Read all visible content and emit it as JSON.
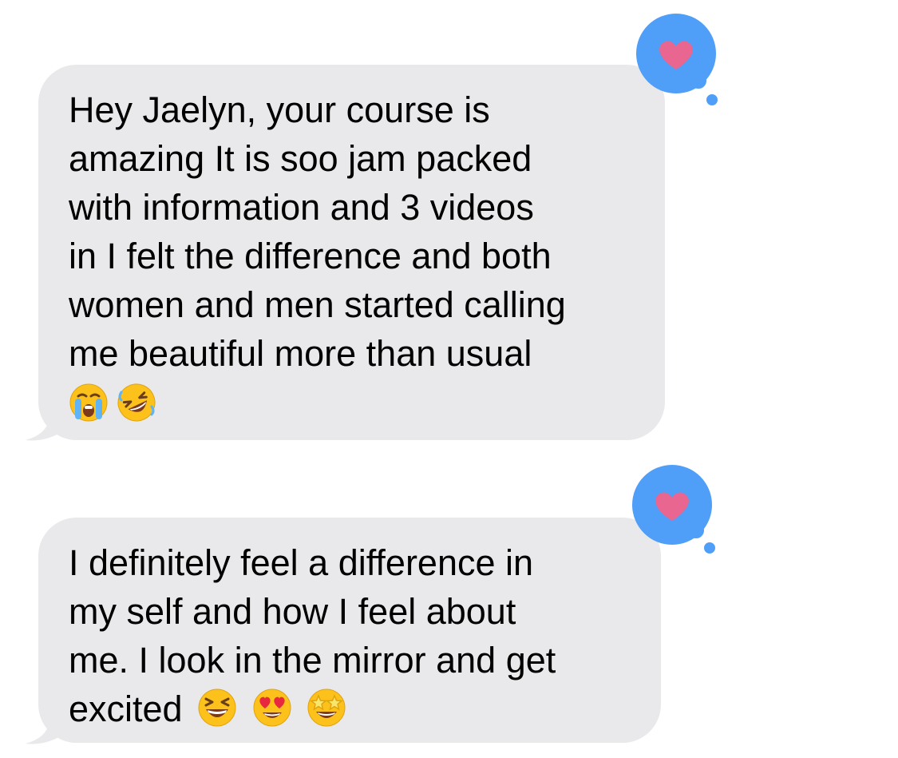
{
  "messages": [
    {
      "lines": [
        "Hey Jaelyn, your course is",
        "amazing It is soo jam packed",
        "with information and 3 videos",
        "in I felt the difference and both",
        "women and men started calling",
        "me beautiful more than usual"
      ],
      "emojis": [
        "crying-face",
        "rolling-on-floor-laughing"
      ],
      "reaction": "heart"
    },
    {
      "lines": [
        "I definitely feel a difference in",
        "my self and how I feel about",
        "me. I look in the mirror and get",
        "excited"
      ],
      "emojis": [
        "grinning-squinting-face",
        "heart-eyes-face",
        "star-struck-face"
      ],
      "reaction": "heart"
    }
  ],
  "colors": {
    "bubble": "#e9e9eb",
    "tapback_blue": "#4f9ef7",
    "heart_pink": "#e8668f"
  }
}
